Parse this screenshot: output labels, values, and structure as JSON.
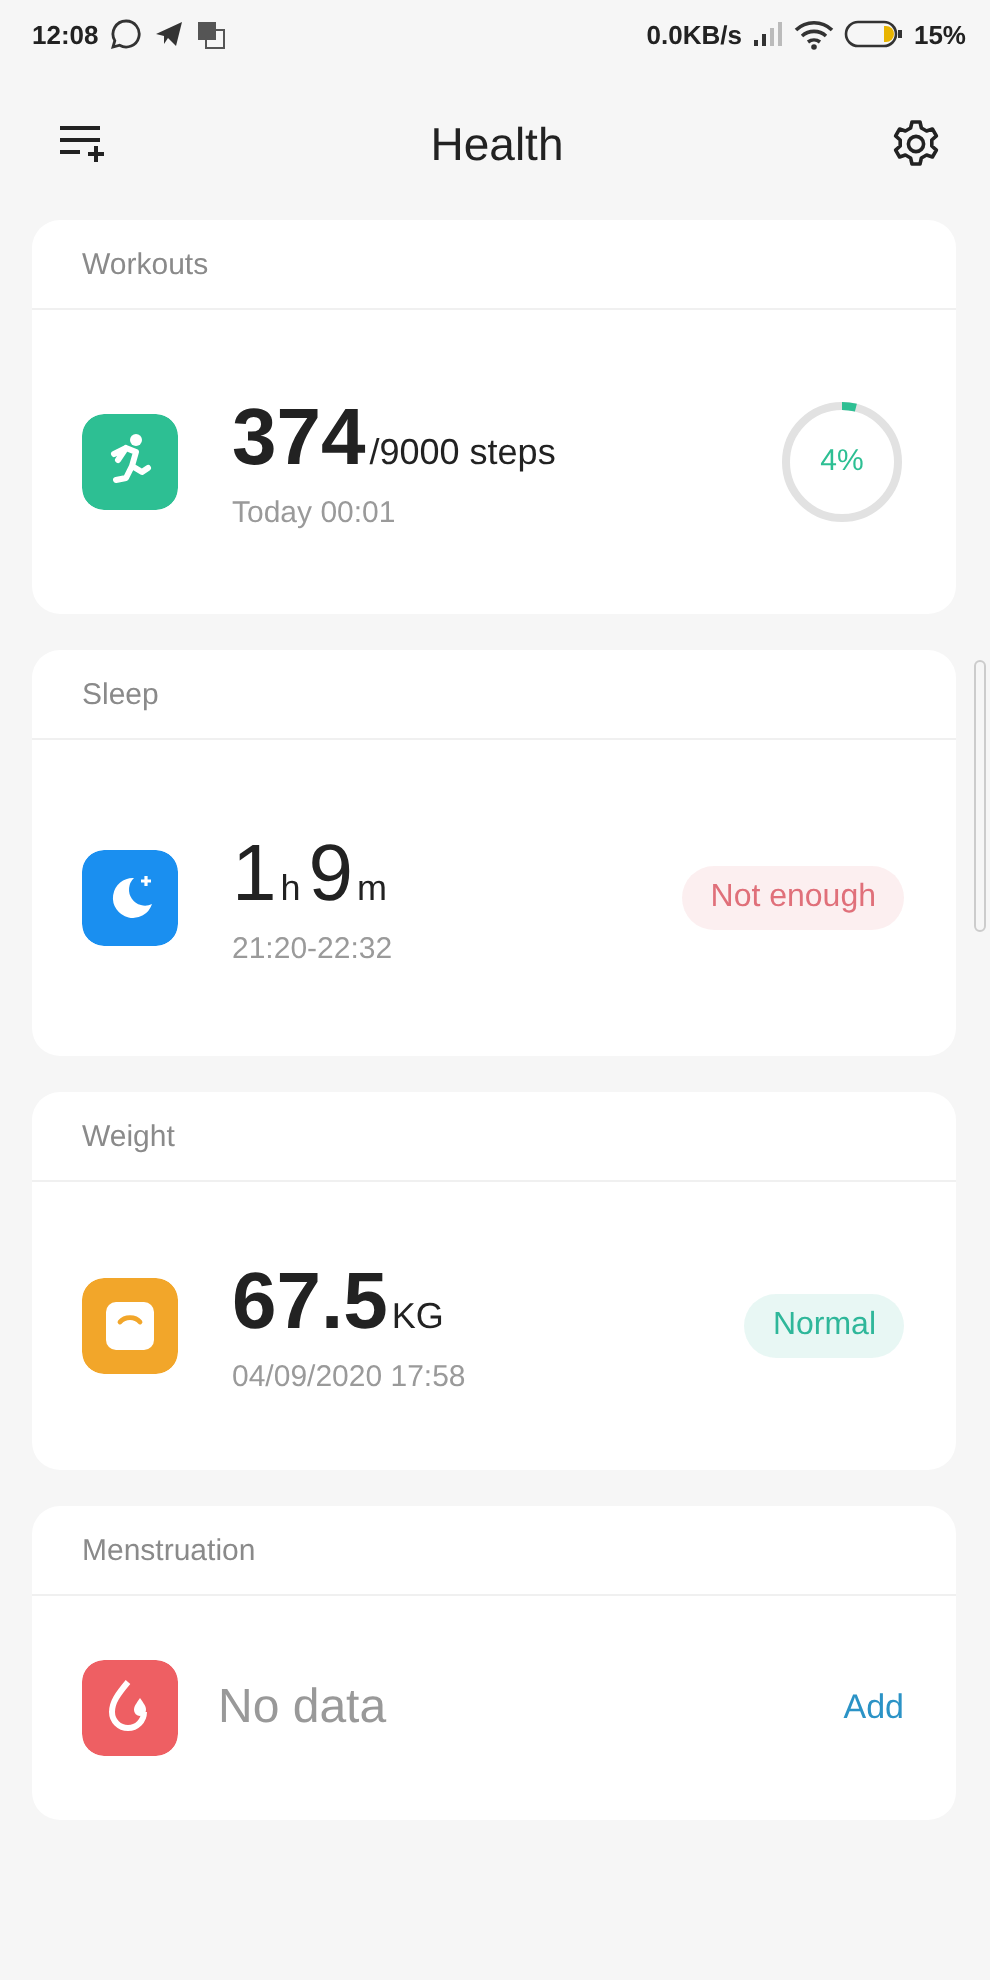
{
  "status_bar": {
    "time": "12:08",
    "network_speed": "0.0KB/s",
    "battery": "15%"
  },
  "header": {
    "title": "Health"
  },
  "cards": [
    {
      "kind": "steps",
      "title": "Workouts",
      "color": "#2dbf93",
      "value_bold": true,
      "value_parts": [
        {
          "text": "374",
          "kind": "number"
        },
        {
          "text": "/9000 steps",
          "kind": "unit"
        }
      ],
      "subtitle": "Today 00:01",
      "progress": {
        "level": 0.04,
        "label": "4%"
      }
    },
    {
      "kind": "sleep",
      "title": "Sleep",
      "color": "#1a8ff0",
      "value_bold": false,
      "value_parts": [
        {
          "text": "1",
          "kind": "number"
        },
        {
          "text": "h",
          "kind": "unit"
        },
        {
          "text": "9",
          "kind": "number"
        },
        {
          "text": "m",
          "kind": "unit"
        }
      ],
      "subtitle": "21:20-22:32",
      "badge": {
        "text": "Not enough",
        "color": "#e0707a"
      }
    },
    {
      "kind": "weight",
      "title": "Weight",
      "color": "#f2a62a",
      "value_bold": true,
      "value_parts": [
        {
          "text": "67.5",
          "kind": "number"
        },
        {
          "text": "KG",
          "kind": "unit"
        }
      ],
      "subtitle": "04/09/2020 17:58",
      "badge": {
        "text": "Normal",
        "color": "#2fb79a"
      }
    },
    {
      "kind": "empty",
      "title": "Menstruation",
      "color": "#ee5f63",
      "message": "No data",
      "action": "Add"
    }
  ]
}
